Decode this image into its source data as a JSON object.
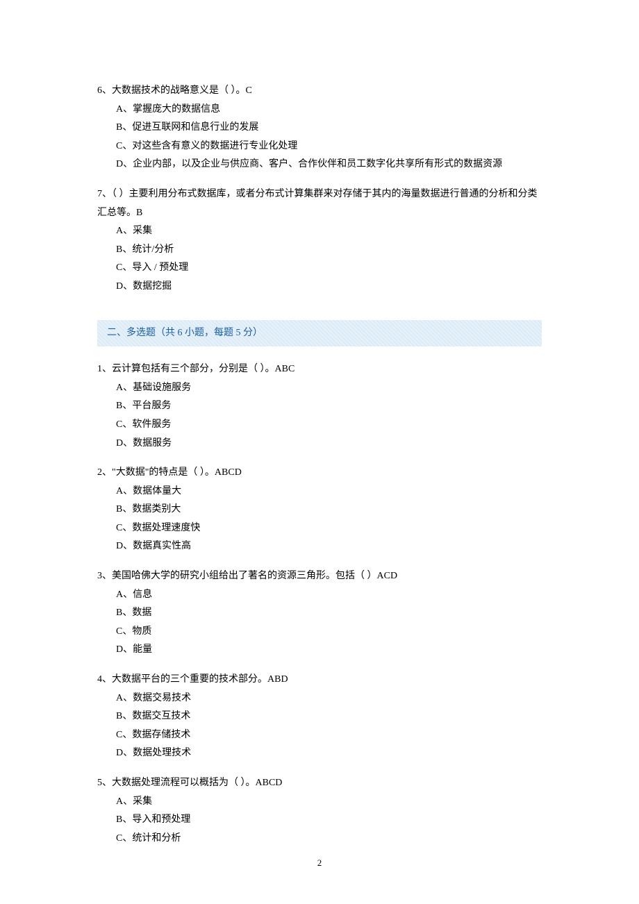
{
  "q6": {
    "text": "6、大数据技术的战略意义是（ ）。C",
    "a": "A、掌握庞大的数据信息",
    "b": "B、促进互联网和信息行业的发展",
    "c": "C、对这些含有意义的数据进行专业化处理",
    "d": "D、企业内部，以及企业与供应商、客户、合作伙伴和员工数字化共享所有形式的数据资源"
  },
  "q7": {
    "text_line1": "7、（ ）主要利用分布式数据库，或者分布式计算集群来对存储于其内的海量数据进行普通的分析和分类",
    "text_line2": "汇总等。B",
    "a": "A、采集",
    "b": "B、统计/分析",
    "c": "C、导入 / 预处理",
    "d": "D、数据挖掘"
  },
  "section2": {
    "title": "二、多选题（共 6 小题，每题 5 分）"
  },
  "mq1": {
    "text": "1、云计算包括有三个部分，分别是（ ）。ABC",
    "a": "A、基础设施服务",
    "b": "B、平台服务",
    "c": "C、软件服务",
    "d": "D、数据服务"
  },
  "mq2": {
    "text": "2、\"大数据\"的特点是（ ）。ABCD",
    "a": "A、数据体量大",
    "b": "B、数据类别大",
    "c": "C、数据处理速度快",
    "d": "D、数据真实性高"
  },
  "mq3": {
    "text": "3、美国哈佛大学的研究小组给出了著名的资源三角形。包括（ ）ACD",
    "a": "A、信息",
    "b": "B、数据",
    "c": "C、物质",
    "d": "D、能量"
  },
  "mq4": {
    "text": "4、大数据平台的三个重要的技术部分。ABD",
    "a": "A、数据交易技术",
    "b": "B、数据交互技术",
    "c": "C、数据存储技术",
    "d": "D、数据处理技术"
  },
  "mq5": {
    "text": "5、大数据处理流程可以概括为（ ）。ABCD",
    "a": "A、采集",
    "b": "B、导入和预处理",
    "c": "C、统计和分析"
  },
  "page_number": "2"
}
